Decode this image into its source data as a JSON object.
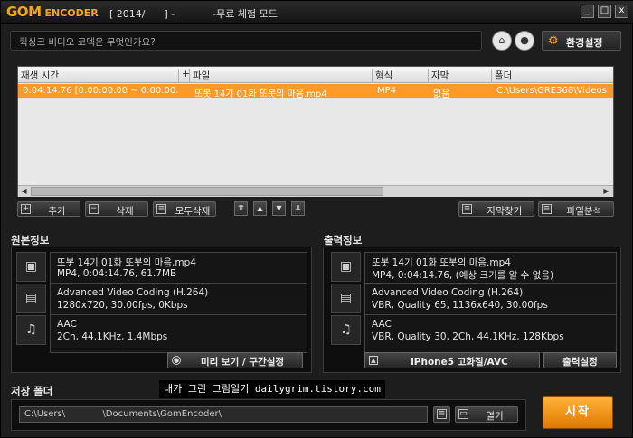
{
  "window": {
    "logo": "GOM",
    "logo_sub": "ENCODER",
    "title": "[ 2014/      ] -            -무료 체험 모드",
    "min": "_",
    "max": "□",
    "close": "x"
  },
  "question_bar": {
    "text": "퀵싱크 비디오 코덱은 무엇인가요?"
  },
  "settings_button": "환경설정",
  "file_list": {
    "columns": [
      "재생 시간",
      "+",
      "파일",
      "형식",
      "자막",
      "폴더"
    ],
    "rows": [
      {
        "duration": "0:04:14.76 [0:00:00.00 ~ 0:00:00.00]",
        "file": "또봇 14기    01화 또봇의 마음.mp4",
        "format": "MP4",
        "subtitle": "없음",
        "folder": "C:\\Users\\GRE368\\Videos"
      }
    ]
  },
  "list_buttons": {
    "add": "추가",
    "delete": "삭제",
    "delete_all": "모두삭제",
    "find_subtitle": "자막찾기",
    "file_analysis": "파일분석"
  },
  "source": {
    "title": "원본정보",
    "file_name": "또봇 14기    01화 또봇의 마음.mp4",
    "file_detail": "MP4, 0:04:14.76, 61.7MB",
    "video_codec": "Advanced Video Coding (H.264)",
    "video_detail": "1280x720, 30.00fps, 0Kbps",
    "audio_codec": "AAC",
    "audio_detail": "2Ch, 44.1KHz, 1.4Mbps",
    "preview_button": "미리 보기 / 구간설정"
  },
  "output": {
    "title": "출력정보",
    "file_name": "또봇 14기    01화 또봇의 마음.mp4",
    "file_detail": "MP4, 0:04:14.76, (예상 크기를 알 수 없음)",
    "video_codec": "Advanced Video Coding (H.264)",
    "video_detail": "VBR, Quality 65, 1136x640, 30.00fps",
    "audio_codec": "AAC",
    "audio_detail": "VBR, Quality 30, 2Ch, 44.1KHz, 128Kbps",
    "preset_button": "iPhone5 고화질/AVC",
    "output_settings_button": "출력설정"
  },
  "save_folder": {
    "title": "저장 폴더",
    "path": "C:\\Users\\             \\Documents\\GomEncoder\\",
    "open_button": "열기"
  },
  "watermark": "내가 그린 그림일기 dailygrim.tistory.com",
  "start_button": "시작",
  "colors": {
    "accent": "#ff9a2a",
    "selected_row": "#ff9a2a"
  }
}
